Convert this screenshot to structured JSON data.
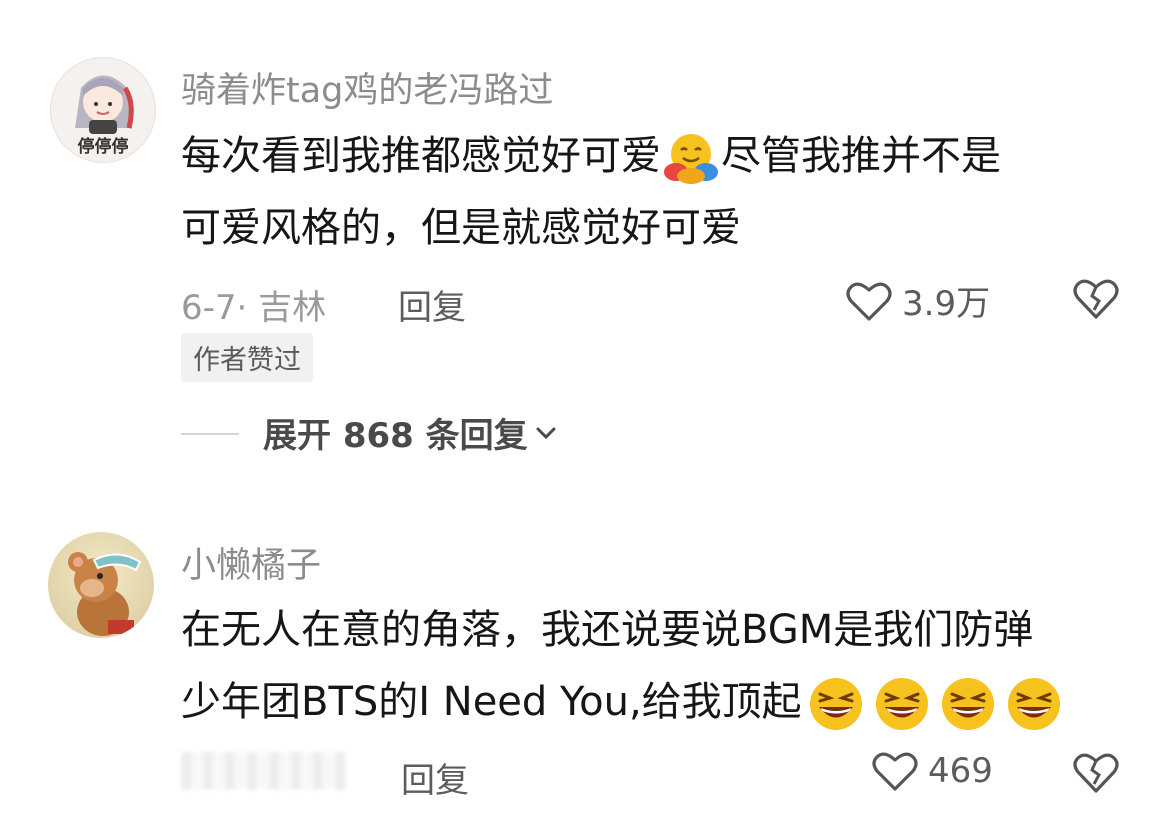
{
  "comments": [
    {
      "username": "骑着炸tag鸡的老冯路过",
      "avatar_text": "停停停",
      "text_line1a": "每次看到我推都感觉好可爱",
      "text_line1b": "尽管我推并不是",
      "text_line2": "可爱风格的，但是就感觉好可爱",
      "emoji": "hugging-face-icon",
      "meta": "6-7· 吉林",
      "reply_label": "回复",
      "like_count": "3.9万",
      "badge": "作者赞过",
      "expand_label": "展开 868 条回复"
    },
    {
      "username": "小懒橘子",
      "text_line1": "在无人在意的角落，我还说要说BGM是我们防弹",
      "text_line2": "少年团BTS的I Need You,给我顶起",
      "emoji": "grimacing-laugh-face-icon",
      "emoji_count": 4,
      "reply_label": "回复",
      "like_count": "469"
    }
  ],
  "colors": {
    "username": "#8c8c8c",
    "text": "#161616",
    "meta": "#9a9a9a",
    "emoji_yellow": "#f7c21d"
  }
}
